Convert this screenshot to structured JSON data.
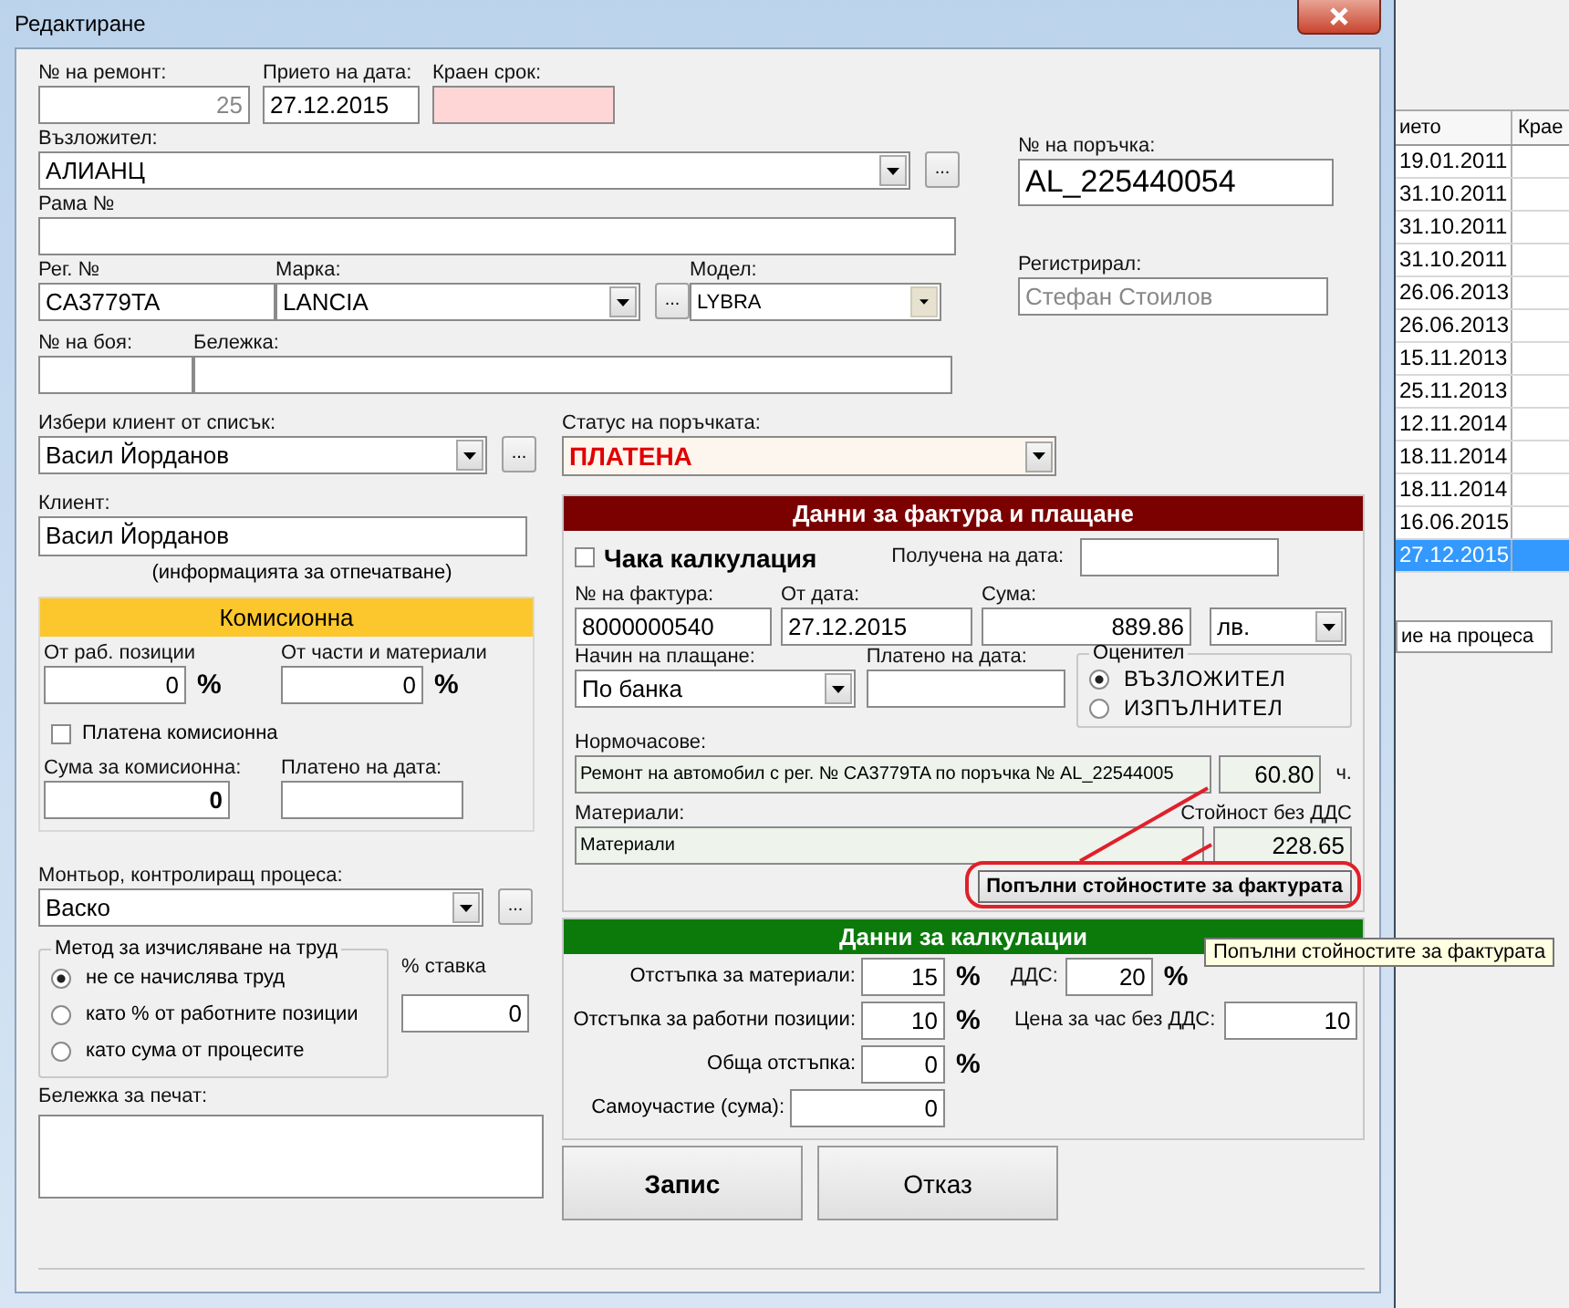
{
  "window": {
    "title": "Редактиране"
  },
  "repair_no": {
    "label": "№ на ремонт:",
    "value": "25",
    "disabled": true
  },
  "received_on": {
    "label": "Прието на дата:",
    "value": "27.12.2015"
  },
  "deadline": {
    "label": "Краен срок:",
    "highlighted": true
  },
  "assignor": {
    "label": "Възложител:",
    "value": "АЛИАНЦ",
    "browse": "..."
  },
  "order_no": {
    "label": "№ на поръчка:",
    "value": "AL_225440054"
  },
  "frame_no": {
    "label": "Рама №"
  },
  "registered_by": {
    "label": "Регистрирал:",
    "value": "Стефан Стоилов",
    "disabled": true
  },
  "reg_no": {
    "label": "Рег. №",
    "value": "CA3779TA"
  },
  "make": {
    "label": "Марка:",
    "value": "LANCIA",
    "browse": "..."
  },
  "model": {
    "label": "Модел:",
    "value": "LYBRA"
  },
  "paint_no": {
    "label": "№ на боя:"
  },
  "note": {
    "label": "Бележка:"
  },
  "client_pick": {
    "label": "Избери клиент от списък:",
    "value": "Васил Йорданов",
    "browse": "..."
  },
  "client": {
    "label": "Клиент:",
    "value": "Васил Йорданов",
    "hint": "(информацията за отпечатване)"
  },
  "commission": {
    "title": "Комисионна",
    "from_positions": {
      "label": "От раб. позиции",
      "value": "0",
      "unit": "%"
    },
    "from_parts": {
      "label": "От части и материали",
      "value": "0",
      "unit": "%"
    },
    "paid": {
      "label": "Платена комисионна",
      "checked": false
    },
    "amount": {
      "label": "Сума за комисионна:",
      "value": "0"
    },
    "paid_on": {
      "label": "Платено на дата:"
    }
  },
  "mechanic": {
    "label": "Монтьор, контролиращ процеса:",
    "value": "Васко",
    "browse": "..."
  },
  "labor_method": {
    "title": "Метод за изчисляване на труд",
    "options": [
      {
        "label": "не се начислява труд",
        "selected": true
      },
      {
        "label": "като % от работните позиции",
        "selected": false
      },
      {
        "label": "като сума от процесите",
        "selected": false
      }
    ]
  },
  "rate": {
    "label": "% ставка",
    "value": "0"
  },
  "print_note": {
    "label": "Бележка за печат:"
  },
  "order_status": {
    "label": "Статус на поръчката:",
    "value": "ПЛАТЕНА"
  },
  "invoice": {
    "title": "Данни за фактура и плащане",
    "awaiting_calc": {
      "label": "Чака калкулация",
      "checked": false
    },
    "received_on": {
      "label": "Получена на дата:"
    },
    "invoice_no": {
      "label": "№ на фактура:",
      "value": "8000000540"
    },
    "date": {
      "label": "От дата:",
      "value": "27.12.2015"
    },
    "amount": {
      "label": "Сума:",
      "value": "889.86"
    },
    "currency": {
      "value": "лв."
    },
    "payment": {
      "label": "Начин на плащане:",
      "value": "По банка"
    },
    "paid_on": {
      "label": "Платено на дата:"
    },
    "assessor": {
      "title": "Оценител",
      "options": [
        {
          "label": "ВЪЗЛОЖИТЕЛ",
          "selected": true
        },
        {
          "label": "ИЗПЪЛНИТЕЛ",
          "selected": false
        }
      ]
    },
    "hours": {
      "label": "Нормочасове:",
      "description": "Ремонт на автомобил с рег. № CA3779TA по поръчка № AL_22544005",
      "value": "60.80",
      "unit": "ч.",
      "readonly": true
    },
    "materials": {
      "label": "Материали:",
      "value_label": "Стойност без ДДС",
      "description": "Материали",
      "value": "228.65",
      "readonly": true
    },
    "fill_button": "Попълни стойностите за фактурата"
  },
  "calc": {
    "title": "Данни за калкулации",
    "materials_discount": {
      "label": "Отстъпка за материали:",
      "value": "15",
      "unit": "%"
    },
    "vat": {
      "label": "ДДС:",
      "value": "20",
      "unit": "%"
    },
    "positions_discount": {
      "label": "Отстъпка за работни позиции:",
      "value": "10",
      "unit": "%"
    },
    "hour_price": {
      "label": "Цена за час без ДДС:",
      "value": "10"
    },
    "total_discount": {
      "label": "Обща отстъпка:",
      "value": "0",
      "unit": "%"
    },
    "co_payment": {
      "label": "Самоучастие (сума):",
      "value": "0"
    }
  },
  "buttons": [
    {
      "label": "Запис",
      "kind": "primary"
    },
    {
      "label": "Отказ",
      "kind": "normal"
    }
  ],
  "tooltip": "Попълни стойностите за фактурата",
  "background_list": {
    "columns": [
      "ието",
      "Крае"
    ],
    "rows": [
      {
        "date": "19.01.2011",
        "selected": false
      },
      {
        "date": "31.10.2011",
        "selected": false
      },
      {
        "date": "31.10.2011",
        "selected": false
      },
      {
        "date": "31.10.2011",
        "selected": false
      },
      {
        "date": "26.06.2013",
        "selected": false
      },
      {
        "date": "26.06.2013",
        "selected": false
      },
      {
        "date": "15.11.2013",
        "selected": false
      },
      {
        "date": "25.11.2013",
        "selected": false
      },
      {
        "date": "12.11.2014",
        "selected": false
      },
      {
        "date": "18.11.2014",
        "selected": false
      },
      {
        "date": "18.11.2014",
        "selected": false
      },
      {
        "date": "16.06.2015",
        "selected": false
      },
      {
        "date": "27.12.2015",
        "selected": true
      }
    ],
    "tab": "ие на процеса"
  }
}
